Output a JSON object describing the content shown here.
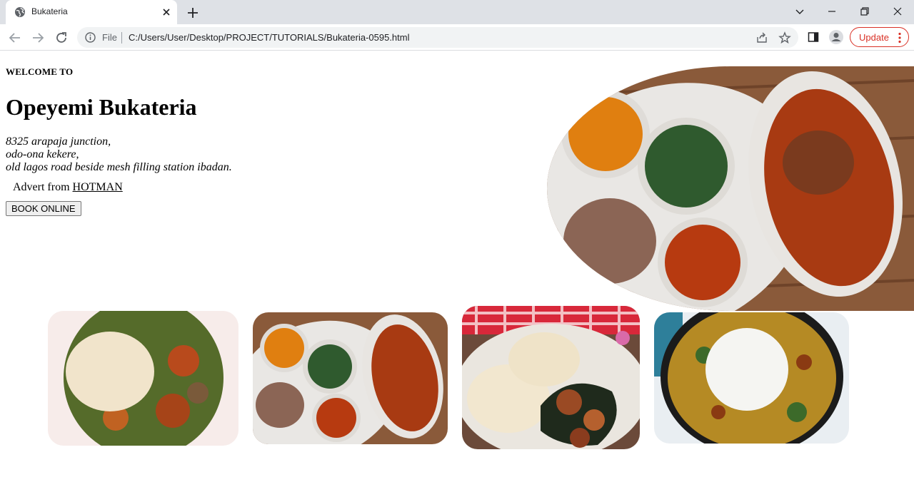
{
  "browser": {
    "tab_title": "Bukateria",
    "omnibox_scheme": "File",
    "url": "C:/Users/User/Desktop/PROJECT/TUTORIALS/Bukateria-0595.html",
    "update_label": "Update",
    "icons": [
      "globe-icon",
      "close-icon",
      "plus-icon",
      "chevron-down-icon",
      "minimize-icon",
      "restore-icon",
      "window-close-icon",
      "back-arrow-icon",
      "forward-arrow-icon",
      "reload-icon",
      "info-icon",
      "share-icon",
      "star-icon",
      "side-panel-icon",
      "profile-icon",
      "more-vert-icon"
    ]
  },
  "page": {
    "welcome": "WELCOME TO",
    "title": "Opeyemi Bukateria",
    "address": [
      "8325 arapaja junction,",
      "odo-ona kekere,",
      "old lagos road beside mesh filling station ibadan."
    ],
    "advert_prefix": "Advert from",
    "advert_link": "HOTMAN",
    "book_button": "BOOK ONLINE",
    "images": [
      {
        "alt": "Amala with ewedu, gbegiri and stew"
      },
      {
        "alt": "Pounded yam with efo riro"
      },
      {
        "alt": "Amala with ewedu, gbegiri and stew"
      },
      {
        "alt": "Pounded yam with assorted meat and vegetable soup"
      },
      {
        "alt": "Pounded yam with egusi soup"
      }
    ]
  }
}
